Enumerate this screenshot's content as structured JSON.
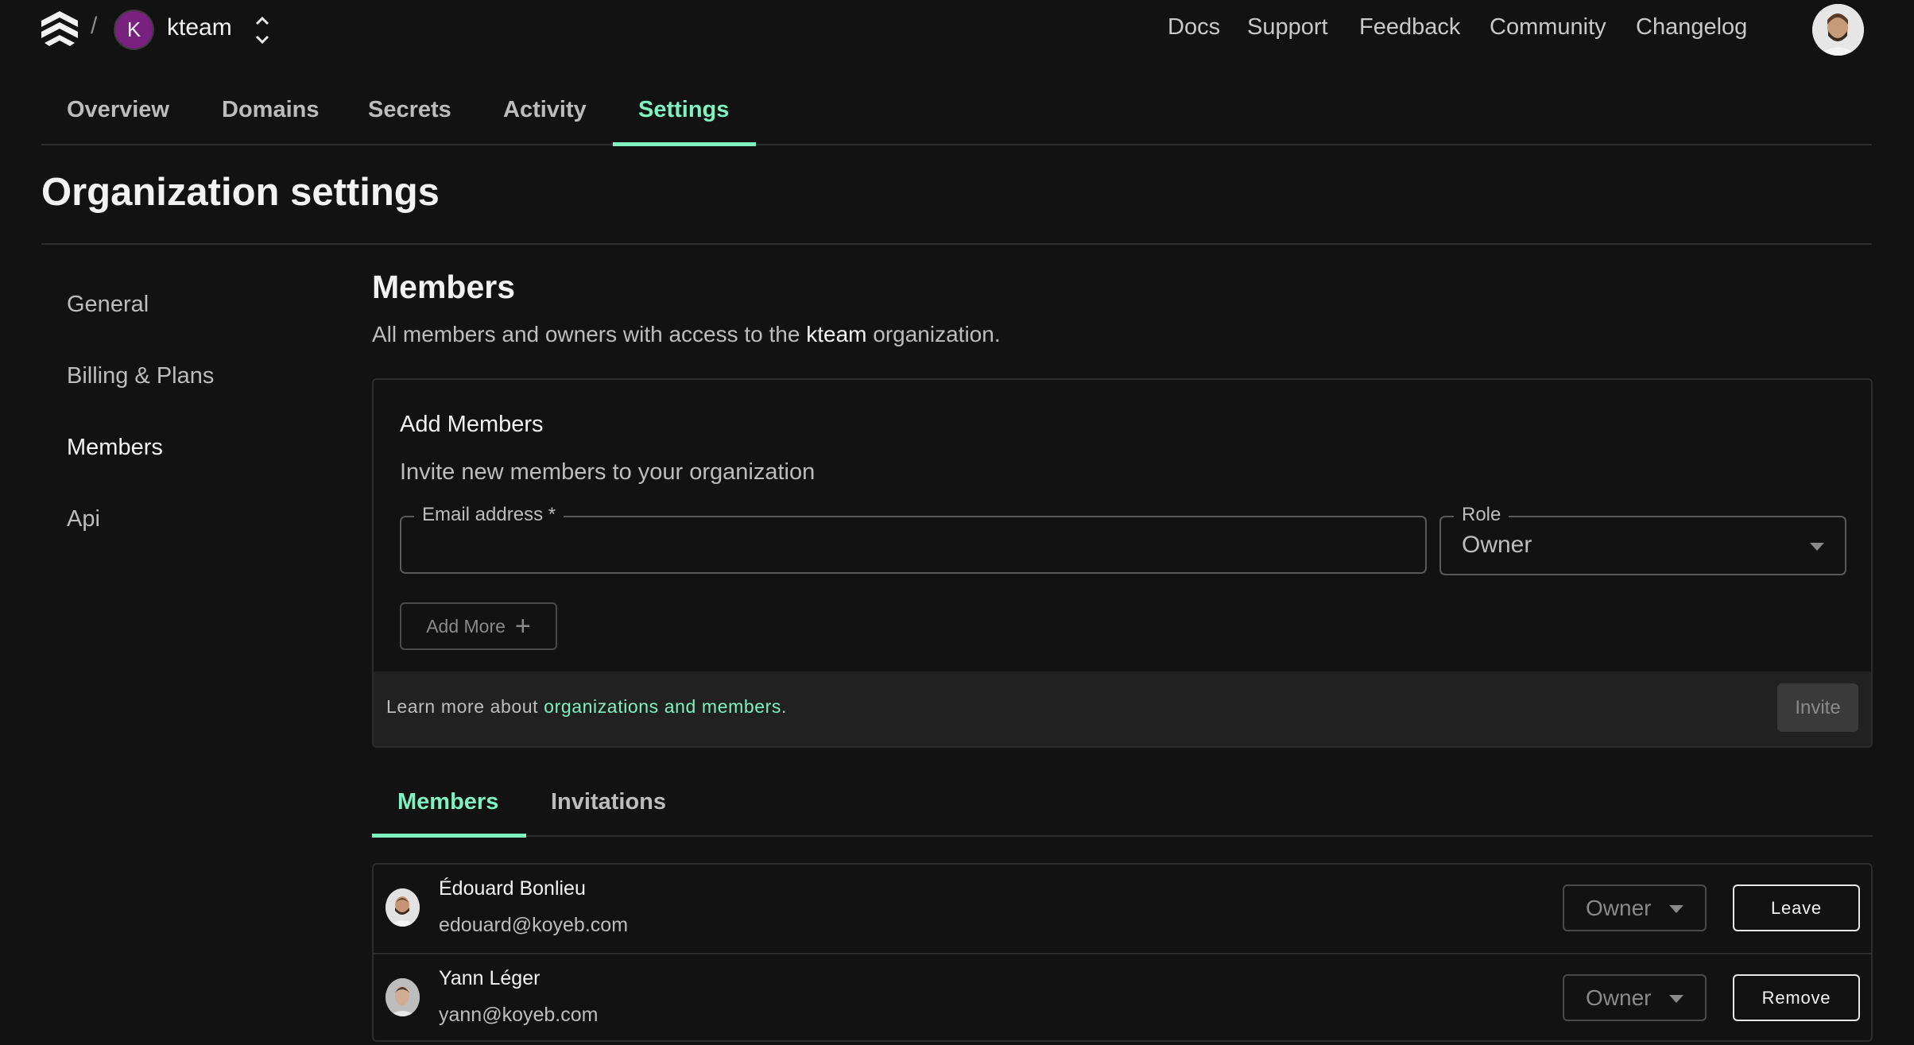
{
  "header": {
    "org_initial": "K",
    "org_name": "kteam",
    "breadcrumb_separator": "/",
    "links": [
      {
        "label": "Docs"
      },
      {
        "label": "Support"
      },
      {
        "label": "Feedback"
      },
      {
        "label": "Community"
      },
      {
        "label": "Changelog"
      }
    ]
  },
  "main_tabs": [
    {
      "label": "Overview",
      "active": false
    },
    {
      "label": "Domains",
      "active": false
    },
    {
      "label": "Secrets",
      "active": false
    },
    {
      "label": "Activity",
      "active": false
    },
    {
      "label": "Settings",
      "active": true
    }
  ],
  "page_title": "Organization settings",
  "sidebar": {
    "items": [
      {
        "label": "General",
        "active": false
      },
      {
        "label": "Billing & Plans",
        "active": false
      },
      {
        "label": "Members",
        "active": true
      },
      {
        "label": "Api",
        "active": false
      }
    ]
  },
  "members_section": {
    "title": "Members",
    "description_prefix": "All members and owners with access to the",
    "description_org": "kteam",
    "description_suffix": "organization."
  },
  "add_members": {
    "title": "Add Members",
    "subtitle": "Invite new members to your organization",
    "email_label": "Email address *",
    "email_value": "",
    "role_label": "Role",
    "role_value": "Owner",
    "add_more_label": "Add More",
    "footer_prefix": "Learn more about",
    "footer_link": "organizations and members",
    "footer_suffix": ".",
    "invite_label": "Invite"
  },
  "sub_tabs": [
    {
      "label": "Members",
      "active": true
    },
    {
      "label": "Invitations",
      "active": false
    }
  ],
  "members": [
    {
      "name": "Édouard Bonlieu",
      "email": "edouard@koyeb.com",
      "role": "Owner",
      "action": "Leave"
    },
    {
      "name": "Yann Léger",
      "email": "yann@koyeb.com",
      "role": "Owner",
      "action": "Remove"
    }
  ],
  "colors": {
    "accent": "#7ef2c0",
    "background": "#121212",
    "org_avatar": "#7a2180"
  }
}
